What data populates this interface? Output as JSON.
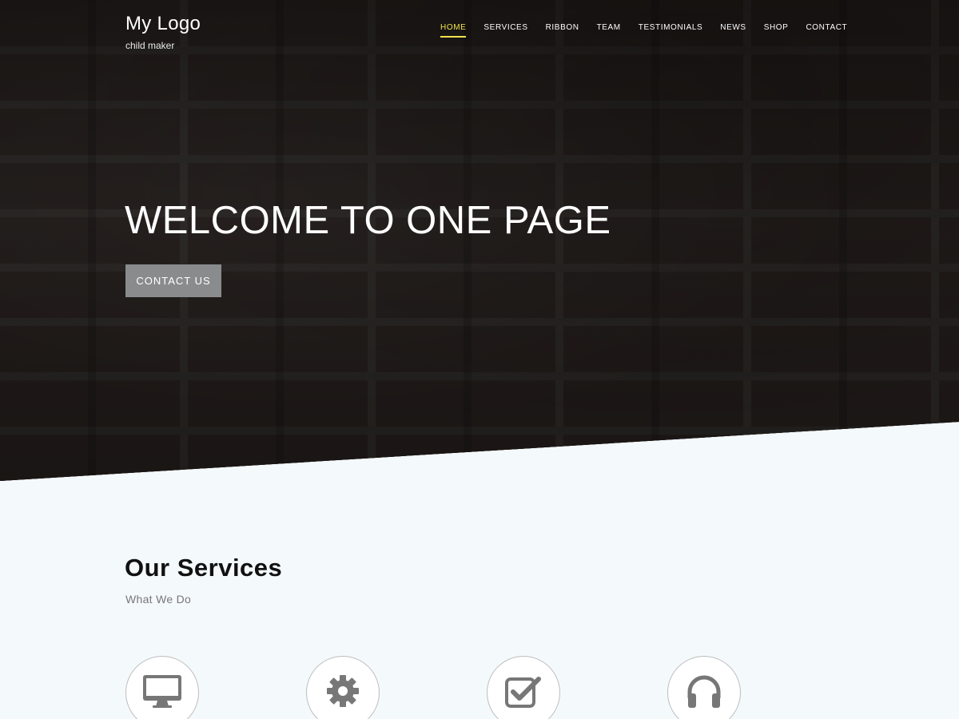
{
  "header": {
    "logo_title": "My Logo",
    "logo_tagline": "child maker"
  },
  "nav": {
    "items": [
      {
        "label": "HOME",
        "active": true
      },
      {
        "label": "SERVICES",
        "active": false
      },
      {
        "label": "RIBBON",
        "active": false
      },
      {
        "label": "TEAM",
        "active": false
      },
      {
        "label": "TESTIMONIALS",
        "active": false
      },
      {
        "label": "NEWS",
        "active": false
      },
      {
        "label": "SHOP",
        "active": false
      },
      {
        "label": "CONTACT",
        "active": false
      }
    ],
    "active_color": "#f0e34a"
  },
  "hero": {
    "title": "WELCOME TO ONE PAGE",
    "button_label": "CONTACT US"
  },
  "services": {
    "title": "Our Services",
    "subtitle": "What We Do",
    "icons": [
      "monitor-icon",
      "gear-icon",
      "checkbox-icon",
      "headphones-icon"
    ]
  }
}
